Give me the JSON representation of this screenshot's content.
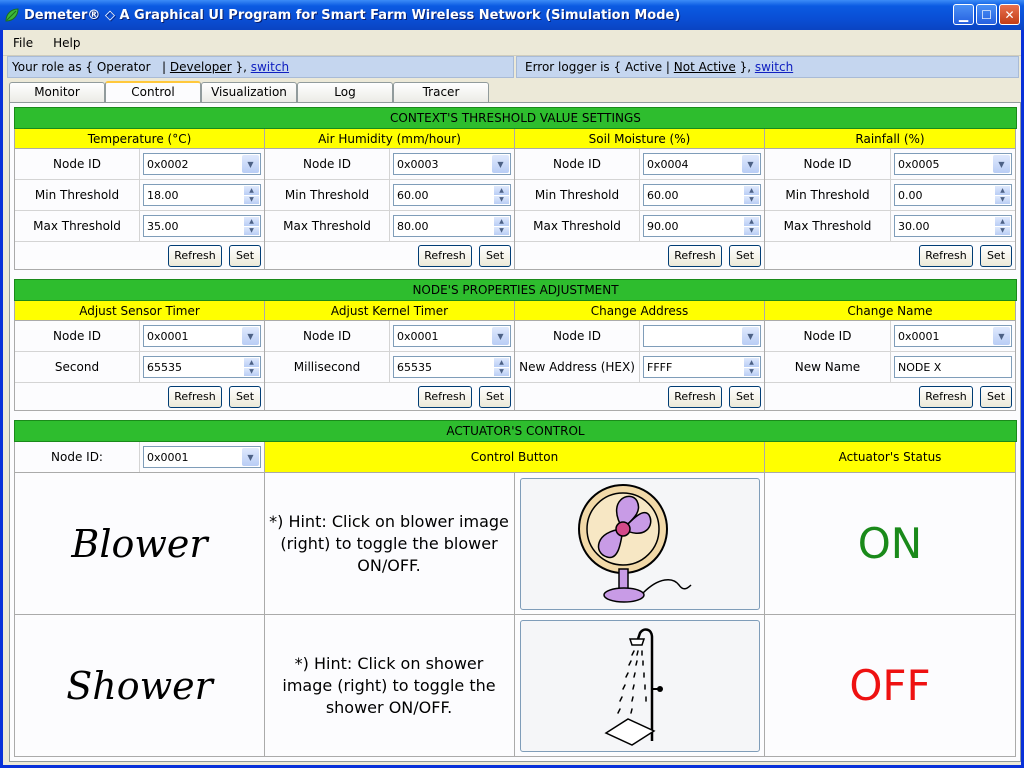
{
  "window": {
    "title": "Demeter® ◇ A Graphical UI Program for Smart Farm Wireless Network (Simulation Mode)"
  },
  "menu": [
    "File",
    "Help"
  ],
  "role": {
    "prefix": "Your role as {",
    "current": "Operator",
    "sep": "|",
    "other": "Developer",
    "suffix": "},",
    "switch": "switch"
  },
  "logger": {
    "prefix": "Error logger is {",
    "current": "Active",
    "sep": "|",
    "other": "Not Active",
    "suffix": "},",
    "switch": "switch"
  },
  "tabs": [
    "Monitor",
    "Control",
    "Visualization",
    "Log",
    "Tracer"
  ],
  "threshold": {
    "title": "CONTEXT'S THRESHOLD VALUE SETTINGS",
    "columns": [
      {
        "header": "Temperature (°C)",
        "node_label": "Node ID",
        "node": "0x0002",
        "min_label": "Min Threshold",
        "min": "18.00",
        "max_label": "Max Threshold",
        "max": "35.00"
      },
      {
        "header": "Air Humidity (mm/hour)",
        "node_label": "Node ID",
        "node": "0x0003",
        "min_label": "Min Threshold",
        "min": "60.00",
        "max_label": "Max Threshold",
        "max": "80.00"
      },
      {
        "header": "Soil Moisture (%)",
        "node_label": "Node ID",
        "node": "0x0004",
        "min_label": "Min Threshold",
        "min": "60.00",
        "max_label": "Max Threshold",
        "max": "90.00"
      },
      {
        "header": "Rainfall (%)",
        "node_label": "Node ID",
        "node": "0x0005",
        "min_label": "Min Threshold",
        "min": "0.00",
        "max_label": "Max Threshold",
        "max": "30.00"
      }
    ],
    "refresh": "Refresh",
    "set": "Set"
  },
  "props": {
    "title": "NODE'S PROPERTIES ADJUSTMENT",
    "columns": [
      {
        "header": "Adjust Sensor Timer",
        "node_label": "Node ID",
        "node": "0x0001",
        "field_label": "Second",
        "field": "65535"
      },
      {
        "header": "Adjust Kernel Timer",
        "node_label": "Node ID",
        "node": "0x0001",
        "field_label": "Millisecond",
        "field": "65535"
      },
      {
        "header": "Change Address",
        "node_label": "Node ID",
        "node": "",
        "field_label": "New Address (HEX)",
        "field": "FFFF"
      },
      {
        "header": "Change Name",
        "node_label": "Node ID",
        "node": "0x0001",
        "field_label": "New Name",
        "field": "NODE X"
      }
    ],
    "refresh": "Refresh",
    "set": "Set"
  },
  "actuator": {
    "title": "ACTUATOR'S CONTROL",
    "node_label": "Node ID:",
    "node": "0x0001",
    "control_header": "Control Button",
    "status_header": "Actuator's Status",
    "rows": [
      {
        "name": "Blower",
        "hint": "*) Hint: Click on blower image (right) to toggle the blower ON/OFF.",
        "status": "ON",
        "status_color": "#1a8a1a"
      },
      {
        "name": "Shower",
        "hint": "*) Hint: Click on shower image (right) to toggle the shower ON/OFF.",
        "status": "OFF",
        "status_color": "#ee1111"
      }
    ]
  }
}
